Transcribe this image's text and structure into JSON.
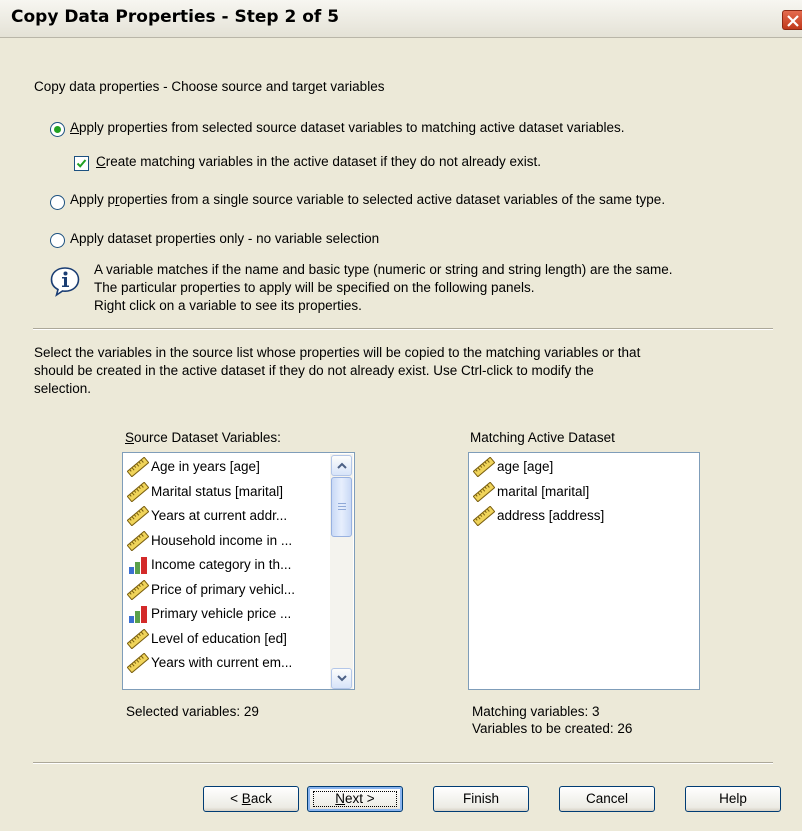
{
  "window": {
    "title": "Copy Data Properties - Step 2 of 5"
  },
  "heading": "Copy data properties - Choose source and target variables",
  "options": {
    "option1": {
      "pre": "",
      "ul": "A",
      "post": "pply properties from selected source dataset variables to matching active dataset variables.",
      "selected": true
    },
    "create_matching": {
      "pre": "",
      "ul": "C",
      "post": "reate matching variables in the active dataset if they do not already  exist.",
      "checked": true
    },
    "option2": {
      "pre": "Apply p",
      "ul": "r",
      "post": "operties from a single source variable to selected active dataset variables of the same type.",
      "selected": false
    },
    "option3": {
      "pre": "Apply dataset properties only -  no variable selection",
      "ul": "",
      "post": "",
      "selected": false
    }
  },
  "info": {
    "line1": "A variable matches if the name and basic type (numeric or string and string length) are the same.",
    "line2": "The particular properties to apply will be specified on the following panels.",
    "line3": "Right click on a variable to see its properties."
  },
  "instructions": {
    "line1": "Select the variables in the source list whose properties will be copied to the matching variables or that",
    "line2": "should be created in the active dataset if they do not already exist. Use Ctrl-click to modify the",
    "line3": "selection."
  },
  "source": {
    "label_ul": "S",
    "label_rest": "ource Dataset Variables:",
    "items": [
      {
        "label": "Age in years [age]",
        "icon": "ruler-icon"
      },
      {
        "label": "Marital status [marital]",
        "icon": "ruler-icon"
      },
      {
        "label": "Years at current addr...",
        "icon": "ruler-icon"
      },
      {
        "label": "Household income in ...",
        "icon": "ruler-icon"
      },
      {
        "label": "Income category in th...",
        "icon": "bar-chart-icon"
      },
      {
        "label": "Price of primary vehicl...",
        "icon": "ruler-icon"
      },
      {
        "label": "Primary vehicle price ...",
        "icon": "bar-chart-icon"
      },
      {
        "label": "Level of education [ed]",
        "icon": "ruler-icon"
      },
      {
        "label": "Years with current em...",
        "icon": "ruler-icon"
      }
    ],
    "count_text": "Selected variables: 29"
  },
  "active": {
    "label": "Matching Active Dataset",
    "items": [
      {
        "label": "age [age]",
        "icon": "ruler-icon"
      },
      {
        "label": "marital [marital]",
        "icon": "ruler-icon"
      },
      {
        "label": "address [address]",
        "icon": "ruler-icon"
      }
    ],
    "matching_text": "Matching variables: 3",
    "created_text": "Variables to be created: 26"
  },
  "buttons": {
    "back_pre": "< ",
    "back_ul": "B",
    "back_post": "ack",
    "next_ul": "N",
    "next_post": "ext >",
    "finish": "Finish",
    "cancel": "Cancel",
    "help": "Help"
  },
  "colors": {
    "dialog_bg": "#ece9d8",
    "radio_dot": "#21a121",
    "border_blue": "#7f9db9",
    "button_border": "#003c74"
  }
}
